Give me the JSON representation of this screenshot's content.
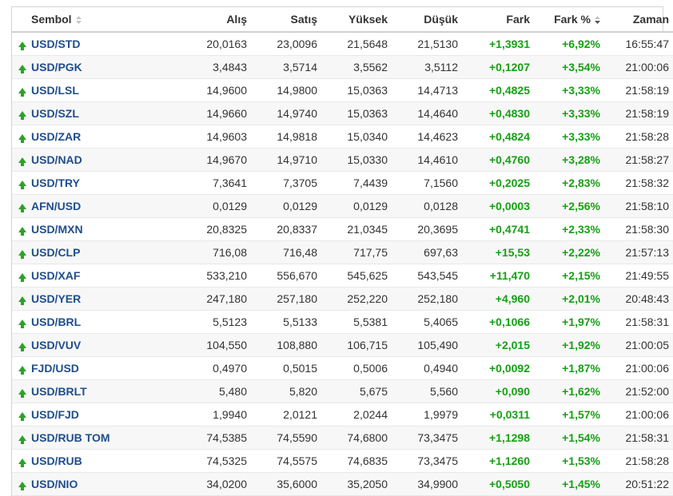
{
  "columns": {
    "symbol": "Sembol",
    "buy": "Alış",
    "sell": "Satış",
    "high": "Yüksek",
    "low": "Düşük",
    "change": "Fark",
    "change_pct": "Fark %",
    "time": "Zaman"
  },
  "colors": {
    "link": "#1f4e8c",
    "positive": "#16a014",
    "up_arrow": "#2da12a"
  },
  "rows": [
    {
      "trend": "up-arrow-icon",
      "symbol": "USD/STD",
      "buy": "20,0163",
      "sell": "23,0096",
      "high": "21,5648",
      "low": "21,5130",
      "change": "+1,3931",
      "change_pct": "+6,92%",
      "time": "16:55:47"
    },
    {
      "trend": "up-arrow-icon",
      "symbol": "USD/PGK",
      "buy": "3,4843",
      "sell": "3,5714",
      "high": "3,5562",
      "low": "3,5112",
      "change": "+0,1207",
      "change_pct": "+3,54%",
      "time": "21:00:06"
    },
    {
      "trend": "up-arrow-icon",
      "symbol": "USD/LSL",
      "buy": "14,9600",
      "sell": "14,9800",
      "high": "15,0363",
      "low": "14,4713",
      "change": "+0,4825",
      "change_pct": "+3,33%",
      "time": "21:58:19"
    },
    {
      "trend": "up-arrow-icon",
      "symbol": "USD/SZL",
      "buy": "14,9660",
      "sell": "14,9740",
      "high": "15,0363",
      "low": "14,4640",
      "change": "+0,4830",
      "change_pct": "+3,33%",
      "time": "21:58:19"
    },
    {
      "trend": "up-arrow-icon",
      "symbol": "USD/ZAR",
      "buy": "14,9603",
      "sell": "14,9818",
      "high": "15,0340",
      "low": "14,4623",
      "change": "+0,4824",
      "change_pct": "+3,33%",
      "time": "21:58:28"
    },
    {
      "trend": "up-arrow-icon",
      "symbol": "USD/NAD",
      "buy": "14,9670",
      "sell": "14,9710",
      "high": "15,0330",
      "low": "14,4610",
      "change": "+0,4760",
      "change_pct": "+3,28%",
      "time": "21:58:27"
    },
    {
      "trend": "up-arrow-icon",
      "symbol": "USD/TRY",
      "buy": "7,3641",
      "sell": "7,3705",
      "high": "7,4439",
      "low": "7,1560",
      "change": "+0,2025",
      "change_pct": "+2,83%",
      "time": "21:58:32"
    },
    {
      "trend": "up-arrow-icon",
      "symbol": "AFN/USD",
      "buy": "0,0129",
      "sell": "0,0129",
      "high": "0,0129",
      "low": "0,0128",
      "change": "+0,0003",
      "change_pct": "+2,56%",
      "time": "21:58:10"
    },
    {
      "trend": "up-arrow-icon",
      "symbol": "USD/MXN",
      "buy": "20,8325",
      "sell": "20,8337",
      "high": "21,0345",
      "low": "20,3695",
      "change": "+0,4741",
      "change_pct": "+2,33%",
      "time": "21:58:30"
    },
    {
      "trend": "up-arrow-icon",
      "symbol": "USD/CLP",
      "buy": "716,08",
      "sell": "716,48",
      "high": "717,75",
      "low": "697,63",
      "change": "+15,53",
      "change_pct": "+2,22%",
      "time": "21:57:13"
    },
    {
      "trend": "up-arrow-icon",
      "symbol": "USD/XAF",
      "buy": "533,210",
      "sell": "556,670",
      "high": "545,625",
      "low": "543,545",
      "change": "+11,470",
      "change_pct": "+2,15%",
      "time": "21:49:55"
    },
    {
      "trend": "up-arrow-icon",
      "symbol": "USD/YER",
      "buy": "247,180",
      "sell": "257,180",
      "high": "252,220",
      "low": "252,180",
      "change": "+4,960",
      "change_pct": "+2,01%",
      "time": "20:48:43"
    },
    {
      "trend": "up-arrow-icon",
      "symbol": "USD/BRL",
      "buy": "5,5123",
      "sell": "5,5133",
      "high": "5,5381",
      "low": "5,4065",
      "change": "+0,1066",
      "change_pct": "+1,97%",
      "time": "21:58:31"
    },
    {
      "trend": "up-arrow-icon",
      "symbol": "USD/VUV",
      "buy": "104,550",
      "sell": "108,880",
      "high": "106,715",
      "low": "105,490",
      "change": "+2,015",
      "change_pct": "+1,92%",
      "time": "21:00:05"
    },
    {
      "trend": "up-arrow-icon",
      "symbol": "FJD/USD",
      "buy": "0,4970",
      "sell": "0,5015",
      "high": "0,5006",
      "low": "0,4940",
      "change": "+0,0092",
      "change_pct": "+1,87%",
      "time": "21:00:06"
    },
    {
      "trend": "up-arrow-icon",
      "symbol": "USD/BRLT",
      "buy": "5,480",
      "sell": "5,820",
      "high": "5,675",
      "low": "5,560",
      "change": "+0,090",
      "change_pct": "+1,62%",
      "time": "21:52:00"
    },
    {
      "trend": "up-arrow-icon",
      "symbol": "USD/FJD",
      "buy": "1,9940",
      "sell": "2,0121",
      "high": "2,0244",
      "low": "1,9979",
      "change": "+0,0311",
      "change_pct": "+1,57%",
      "time": "21:00:06"
    },
    {
      "trend": "up-arrow-icon",
      "symbol": "USD/RUB TOM",
      "buy": "74,5385",
      "sell": "74,5590",
      "high": "74,6800",
      "low": "73,3475",
      "change": "+1,1298",
      "change_pct": "+1,54%",
      "time": "21:58:31"
    },
    {
      "trend": "up-arrow-icon",
      "symbol": "USD/RUB",
      "buy": "74,5325",
      "sell": "74,5575",
      "high": "74,6835",
      "low": "73,3475",
      "change": "+1,1260",
      "change_pct": "+1,53%",
      "time": "21:58:28"
    },
    {
      "trend": "up-arrow-icon",
      "symbol": "USD/NIO",
      "buy": "34,0200",
      "sell": "35,6000",
      "high": "35,2050",
      "low": "34,9900",
      "change": "+0,5050",
      "change_pct": "+1,45%",
      "time": "20:51:22"
    }
  ]
}
